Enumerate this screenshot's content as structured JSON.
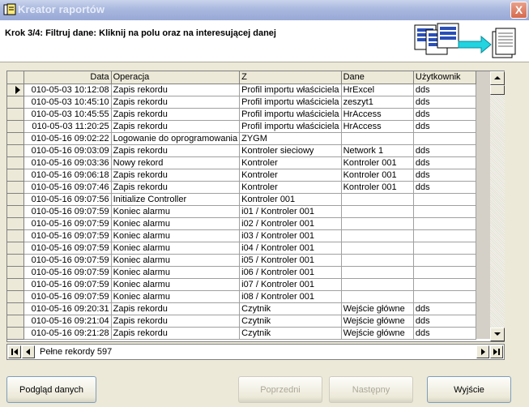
{
  "window": {
    "title": "Kreator raportów",
    "close_label": "X"
  },
  "header": {
    "step_text": "Krok 3/4: Filtruj dane: Kliknij na polu oraz na interesującej danej"
  },
  "grid": {
    "columns": [
      "Data",
      "Operacja",
      "Z",
      "Dane",
      "Użytkownik"
    ],
    "rows": [
      [
        "010-05-03 10:12:08",
        "Zapis rekordu",
        "Profil importu właściciela",
        "HrExcel",
        "dds"
      ],
      [
        "010-05-03 10:45:10",
        "Zapis rekordu",
        "Profil importu właściciela",
        "zeszyt1",
        "dds"
      ],
      [
        "010-05-03 10:45:55",
        "Zapis rekordu",
        "Profil importu właściciela",
        "HrAccess",
        "dds"
      ],
      [
        "010-05-03 11:20:25",
        "Zapis rekordu",
        "Profil importu właściciela",
        "HrAccess",
        "dds"
      ],
      [
        "010-05-16 09:02:22",
        "Logowanie do oprogramowania",
        "ZYGM",
        "",
        ""
      ],
      [
        "010-05-16 09:03:09",
        "Zapis rekordu",
        "Kontroler sieciowy",
        "Network 1",
        "dds"
      ],
      [
        "010-05-16 09:03:36",
        "Nowy rekord",
        "Kontroler",
        "Kontroler 001",
        "dds"
      ],
      [
        "010-05-16 09:06:18",
        "Zapis rekordu",
        "Kontroler",
        "Kontroler 001",
        "dds"
      ],
      [
        "010-05-16 09:07:46",
        "Zapis rekordu",
        "Kontroler",
        "Kontroler 001",
        "dds"
      ],
      [
        "010-05-16 09:07:56",
        "Initialize Controller",
        "Kontroler 001",
        "",
        ""
      ],
      [
        "010-05-16 09:07:59",
        "Koniec alarmu",
        "i01 / Kontroler 001",
        "",
        ""
      ],
      [
        "010-05-16 09:07:59",
        "Koniec alarmu",
        "i02 / Kontroler 001",
        "",
        ""
      ],
      [
        "010-05-16 09:07:59",
        "Koniec alarmu",
        "i03 / Kontroler 001",
        "",
        ""
      ],
      [
        "010-05-16 09:07:59",
        "Koniec alarmu",
        "i04 / Kontroler 001",
        "",
        ""
      ],
      [
        "010-05-16 09:07:59",
        "Koniec alarmu",
        "i05 / Kontroler 001",
        "",
        ""
      ],
      [
        "010-05-16 09:07:59",
        "Koniec alarmu",
        "i06 / Kontroler 001",
        "",
        ""
      ],
      [
        "010-05-16 09:07:59",
        "Koniec alarmu",
        "i07 / Kontroler 001",
        "",
        ""
      ],
      [
        "010-05-16 09:07:59",
        "Koniec alarmu",
        "i08 / Kontroler 001",
        "",
        ""
      ],
      [
        "010-05-16 09:20:31",
        "Zapis rekordu",
        "Czytnik",
        "Wejście główne",
        "dds"
      ],
      [
        "010-05-16 09:21:04",
        "Zapis rekordu",
        "Czytnik",
        "Wejście główne",
        "dds"
      ],
      [
        "010-05-16 09:21:28",
        "Zapis rekordu",
        "Czytnik",
        "Wejście główne",
        "dds"
      ]
    ]
  },
  "navigator": {
    "status": "Pełne rekordy 597"
  },
  "buttons": {
    "preview": "Podgląd danych",
    "prev": "Poprzedni",
    "next": "Następny",
    "exit": "Wyjście"
  }
}
